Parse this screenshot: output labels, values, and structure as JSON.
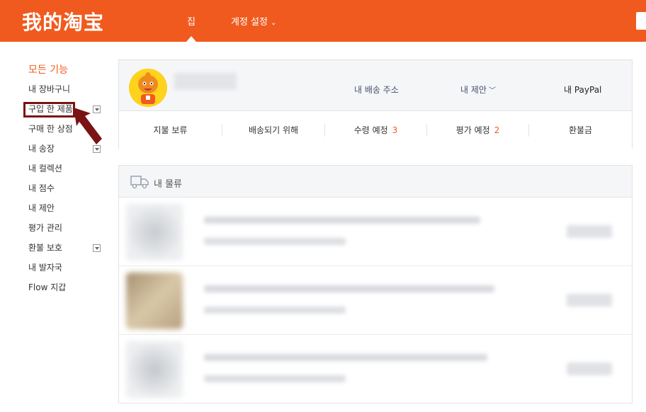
{
  "header": {
    "logo_text": "我的淘宝",
    "nav_home": "집",
    "nav_settings": "계정 설정",
    "brand_color": "#f05a1e"
  },
  "sidebar": {
    "title": "모든 기능",
    "items": [
      {
        "label": "내 장바구니",
        "expandable": false
      },
      {
        "label": "구입 한 제품",
        "expandable": true,
        "highlighted": true
      },
      {
        "label": "구매 한 상점",
        "expandable": false
      },
      {
        "label": "내 송장",
        "expandable": true
      },
      {
        "label": "내 컬렉션",
        "expandable": false
      },
      {
        "label": "내 점수",
        "expandable": false
      },
      {
        "label": "내 제안",
        "expandable": false
      },
      {
        "label": "평가 관리",
        "expandable": false
      },
      {
        "label": "환불 보호",
        "expandable": true
      },
      {
        "label": "내 발자국",
        "expandable": false
      },
      {
        "label": "Flow 지갑",
        "expandable": false
      }
    ]
  },
  "profile": {
    "address_link": "내 배송 주소",
    "suggest_link": "내 제안",
    "paypal_link": "내 PayPal"
  },
  "order_status": [
    {
      "label": "지불 보류",
      "count": ""
    },
    {
      "label": "배송되기 위해",
      "count": ""
    },
    {
      "label": "수령 예정",
      "count": "3"
    },
    {
      "label": "평가 예정",
      "count": "2"
    },
    {
      "label": "환불금",
      "count": ""
    }
  ],
  "logistics": {
    "title": "내 물류",
    "icon": "truck-icon"
  }
}
